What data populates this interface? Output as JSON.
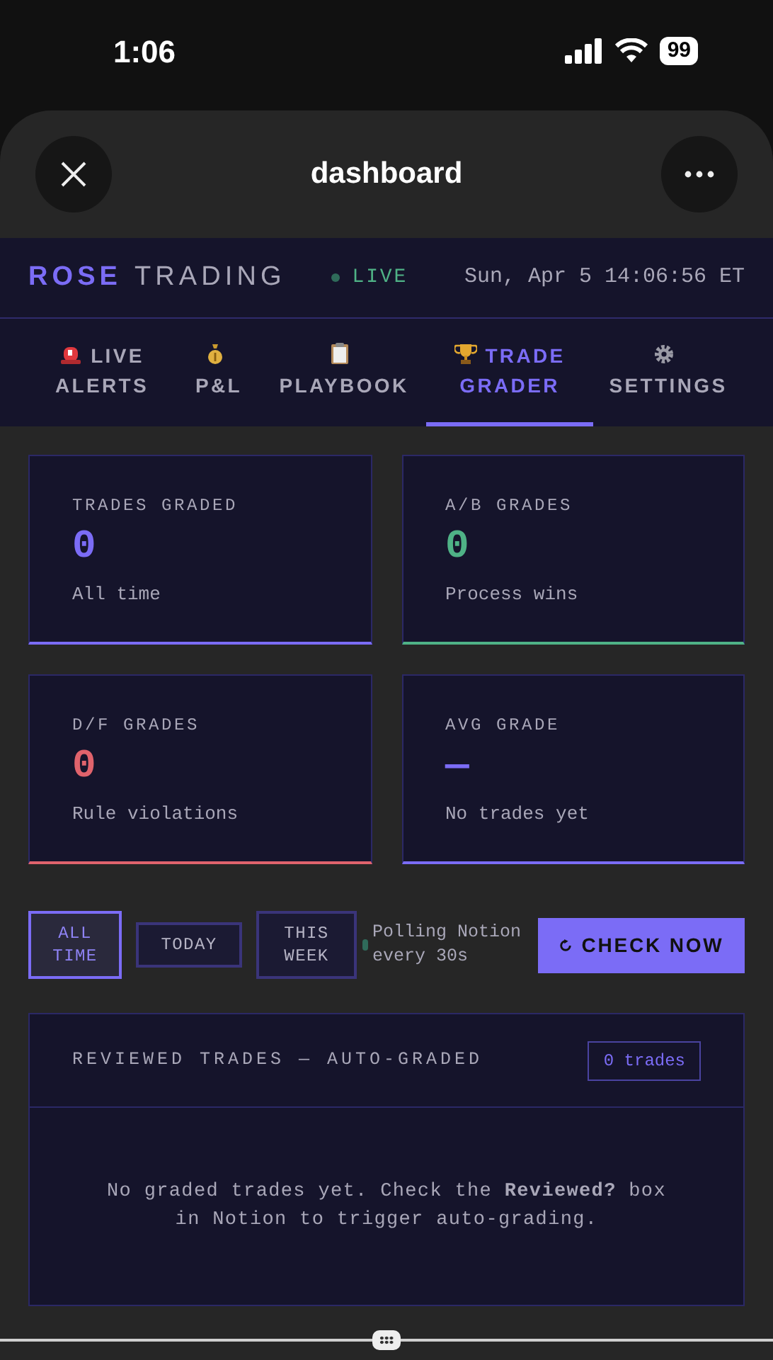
{
  "status_bar": {
    "time": "1:06",
    "battery": "99"
  },
  "sheet": {
    "title": "dashboard"
  },
  "header": {
    "brand": "ROSE",
    "brand_suffix": "TRADING",
    "live": {
      "label": "LIVE",
      "on": true
    },
    "datetime": "Sun, Apr 5 14:06:56 ET"
  },
  "tabs": [
    {
      "kind": "siren",
      "label": "LIVE ALERTS",
      "selected": false
    },
    {
      "kind": "moneybag",
      "label": "P&L",
      "selected": false
    },
    {
      "kind": "clipboard",
      "label": "PLAYBOOK",
      "selected": false
    },
    {
      "kind": "trophy",
      "label": "TRADE GRADER",
      "selected": true
    },
    {
      "kind": "gear",
      "label": "SETTINGS",
      "selected": false
    }
  ],
  "stats": [
    {
      "label": "TRADES GRADED",
      "value": "0",
      "note": "All time",
      "color": "#7b6cf6"
    },
    {
      "label": "A/B GRADES",
      "value": "0",
      "note": "Process wins",
      "color": "#4fb286"
    },
    {
      "label": "D/F GRADES",
      "value": "0",
      "note": "Rule violations",
      "color": "#e0636c"
    },
    {
      "label": "AVG GRADE",
      "value": "—",
      "note": "No trades yet",
      "color": "#7b6cf6"
    }
  ],
  "filters": [
    {
      "label": "ALL TIME",
      "selected": true
    },
    {
      "label": "TODAY",
      "selected": false
    },
    {
      "label": "THIS WEEK",
      "selected": false
    }
  ],
  "polling": "Polling Notion every 30s",
  "check_button": {
    "label": "CHECK NOW"
  },
  "panel": {
    "title": "REVIEWED TRADES — AUTO-GRADED",
    "badge": "0 trades",
    "empty_message": "No graded trades yet. Check the **Reviewed?** box in Notion to trigger auto-grading."
  }
}
